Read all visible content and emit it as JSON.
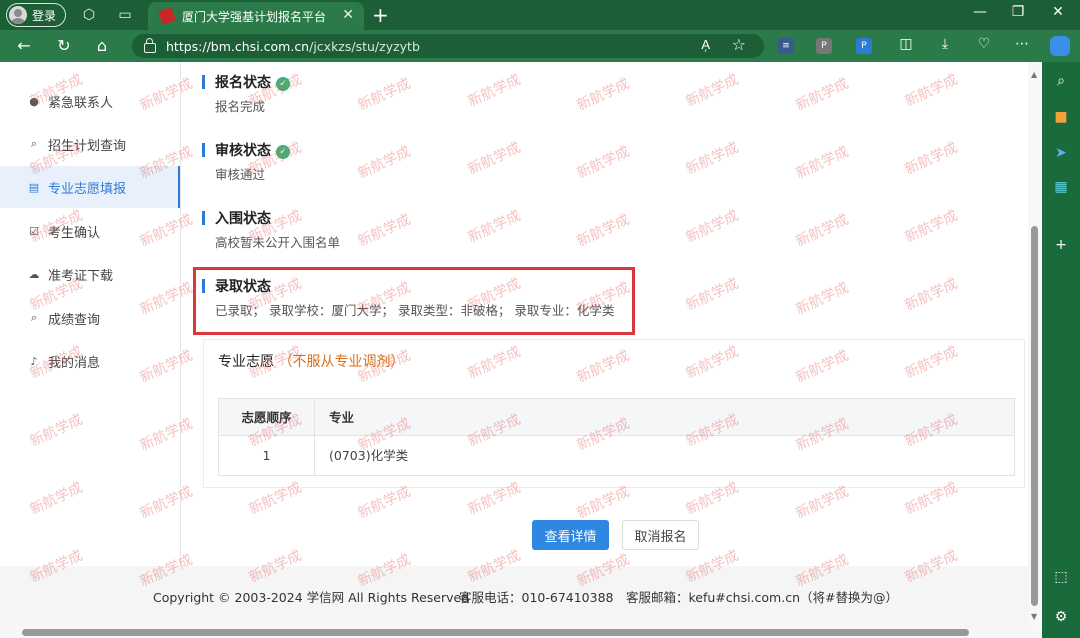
{
  "browser": {
    "login_label": "登录",
    "tab_title": "厦门大学强基计划报名平台",
    "url_host": "https://bm.chsi.com.cn",
    "url_path": "/jcxkzs/stu/zyzytb"
  },
  "sidebar": {
    "items": [
      {
        "label": "紧急联系人",
        "icon": "user-icon"
      },
      {
        "label": "招生计划查询",
        "icon": "search-icon"
      },
      {
        "label": "专业志愿填报",
        "icon": "document-icon"
      },
      {
        "label": "考生确认",
        "icon": "checkbox-icon"
      },
      {
        "label": "准考证下载",
        "icon": "cloud-download-icon"
      },
      {
        "label": "成绩查询",
        "icon": "search-icon"
      },
      {
        "label": "我的消息",
        "icon": "bell-icon"
      }
    ]
  },
  "status": {
    "signup": {
      "title": "报名状态",
      "value": "报名完成"
    },
    "review": {
      "title": "审核状态",
      "value": "审核通过"
    },
    "shortlist": {
      "title": "入围状态",
      "value": "高校暂未公开入围名单"
    },
    "admission": {
      "title": "录取状态",
      "value": "已录取；  录取学校：厦门大学；  录取类型：非破格；  录取专业：化学类"
    }
  },
  "preference": {
    "title": "专业志愿",
    "note": "（不服从专业调剂）",
    "columns": [
      "志愿顺序",
      "专业"
    ],
    "rows": [
      [
        "1",
        "(0703)化学类"
      ]
    ]
  },
  "actions": {
    "details_label": "查看详情",
    "cancel_label": "取消报名"
  },
  "footer": {
    "copyright": "Copyright © 2003-2024 学信网 All Rights Reserved",
    "phone": "客服电话：010-67410388",
    "email": "客服邮箱：kefu#chsi.com.cn（将#替换为@）"
  },
  "watermark_text": "新航学成",
  "colors": {
    "accent": "#2e7bd6",
    "highlight_border": "#d9363e",
    "warning": "#d5711f",
    "success": "#3db37a"
  }
}
